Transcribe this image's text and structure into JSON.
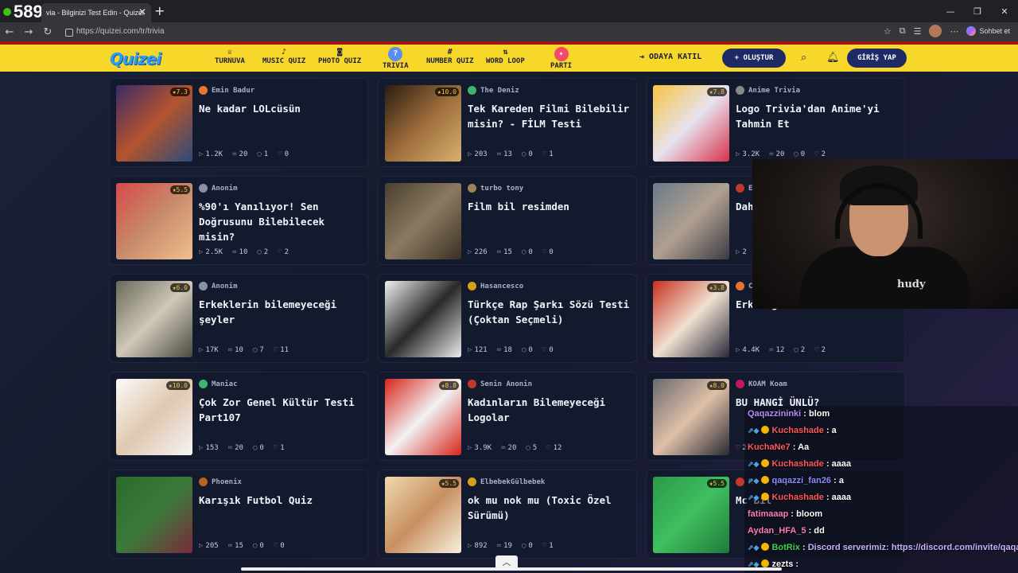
{
  "stream": {
    "viewer_count": "589"
  },
  "browser": {
    "tab_title": "via - Bilginizi Test Edin - Quizei",
    "url": "https://quizei.com/tr/trivia",
    "copilot_label": "Sohbet et"
  },
  "site": {
    "logo": "Quizei",
    "nav": [
      {
        "label": "TURNUVA",
        "icon": "trophy-icon"
      },
      {
        "label": "MUSIC QUIZ",
        "icon": "music-icon"
      },
      {
        "label": "PHOTO QUIZ",
        "icon": "camera-icon"
      },
      {
        "label": "TRIVIA",
        "icon": "trivia-icon"
      },
      {
        "label": "NUMBER QUIZ",
        "icon": "hash-icon"
      },
      {
        "label": "WORD LOOP",
        "icon": "word-loop-icon"
      },
      {
        "label": "PARTI",
        "icon": "party-icon"
      }
    ],
    "join_room": "ODAYA KATIL",
    "create": "OLUŞTUR",
    "login": "GİRİŞ YAP"
  },
  "quizzes": [
    {
      "author": "Emin Badur",
      "title": "Ne kadar LOLcüsün",
      "rating": "7.3",
      "plays": "1.2K",
      "questions": "20",
      "comments": "1",
      "likes": "0",
      "avatar": "#e8742f"
    },
    {
      "author": "The Deniz",
      "title": "Tek Kareden Filmi Bilebilir misin? - FİLM Testi",
      "rating": "10.0",
      "plays": "203",
      "questions": "13",
      "comments": "0",
      "likes": "1",
      "avatar": "#3cb371"
    },
    {
      "author": "Anime Trivia",
      "title": "Logo Trivia'dan Anime'yi Tahmin Et",
      "rating": "7.8",
      "plays": "3.2K",
      "questions": "20",
      "comments": "0",
      "likes": "2",
      "avatar": "#888"
    },
    {
      "author": "Anonim",
      "title": "%90'ı Yanılıyor! Sen Doğrusunu Bilebilecek misin?",
      "rating": "5.5",
      "plays": "2.5K",
      "questions": "10",
      "comments": "2",
      "likes": "2",
      "avatar": "#8a8fa8"
    },
    {
      "author": "turbo tony",
      "title": "Film bil resimden",
      "rating": "",
      "plays": "226",
      "questions": "15",
      "comments": "0",
      "likes": "0",
      "avatar": "#a0825a"
    },
    {
      "author": "E",
      "title": "Dah",
      "rating": "",
      "plays": "2",
      "questions": "",
      "comments": "",
      "likes": "",
      "avatar": "#c0392b"
    },
    {
      "author": "Anonim",
      "title": "Erkeklerin bilemeyeceği şeyler",
      "rating": "6.0",
      "plays": "17K",
      "questions": "10",
      "comments": "7",
      "likes": "11",
      "avatar": "#8a8fa8"
    },
    {
      "author": "Hasancesco",
      "title": "Türkçe Rap Şarkı Sözü Testi (Çoktan Seçmeli)",
      "rating": "",
      "plays": "121",
      "questions": "18",
      "comments": "0",
      "likes": "0",
      "avatar": "#d4a017"
    },
    {
      "author": "C",
      "title": "Erk logolar",
      "rating": "3.8",
      "plays": "4.4K",
      "questions": "12",
      "comments": "2",
      "likes": "2",
      "avatar": "#e8742f"
    },
    {
      "author": "Maniac",
      "title": "Çok Zor Genel Kültür Testi Part107",
      "rating": "10.0",
      "plays": "153",
      "questions": "20",
      "comments": "0",
      "likes": "1",
      "avatar": "#3cb371"
    },
    {
      "author": "Senin Anonin",
      "title": "Kadınların Bilemeyeceği Logolar",
      "rating": "8.8",
      "plays": "3.9K",
      "questions": "20",
      "comments": "5",
      "likes": "12",
      "avatar": "#c0392b"
    },
    {
      "author": "KOAM Koam",
      "title": "BU HANGİ ÜNLÜ?",
      "rating": "8.0",
      "plays": "",
      "questions": "",
      "comments": "",
      "likes": "2",
      "avatar": "#c2185b"
    },
    {
      "author": "Phoenix",
      "title": "Karışık Futbol Quiz",
      "rating": "",
      "plays": "205",
      "questions": "15",
      "comments": "0",
      "likes": "0",
      "avatar": "#b5651d"
    },
    {
      "author": "ElbebekGülbebek",
      "title": "ok mu nok mu (Toxic Özel Sürümü)",
      "rating": "5.5",
      "plays": "892",
      "questions": "19",
      "comments": "0",
      "likes": "1",
      "avatar": "#d4a017"
    },
    {
      "author": "M",
      "title": "Mc Bil",
      "rating": "5.5",
      "plays": "",
      "questions": "",
      "comments": "",
      "likes": "",
      "avatar": "#c0392b"
    }
  ],
  "chat": [
    {
      "user": "Qaqazzininki",
      "color": "#b48cff",
      "msg": "blom",
      "badges": false
    },
    {
      "user": "Kuchashade",
      "color": "#ff5a5a",
      "msg": "a",
      "badges": true
    },
    {
      "user": "KuchaNe7",
      "color": "#ff5a5a",
      "msg": "Aa",
      "badges": false
    },
    {
      "user": "Kuchashade",
      "color": "#ff5a5a",
      "msg": "aaaa",
      "badges": true
    },
    {
      "user": "qaqazzi_fan26",
      "color": "#8f8cff",
      "msg": "a",
      "badges": true
    },
    {
      "user": "Kuchashade",
      "color": "#ff5a5a",
      "msg": "aaaa",
      "badges": true
    },
    {
      "user": "fatimaaap",
      "color": "#ff7ab8",
      "msg": "bloom",
      "badges": false
    },
    {
      "user": "Aydan_HFA_5",
      "color": "#ff7ab8",
      "msg": "dd",
      "badges": false
    },
    {
      "user": "BotRix",
      "color": "#3ed14a",
      "msg": "Discord serverimiz: https://discord.com/invite/qaqazz",
      "badges": true
    },
    {
      "user": "zezts",
      "color": "#ffffff",
      "msg": "",
      "badges": true
    }
  ]
}
